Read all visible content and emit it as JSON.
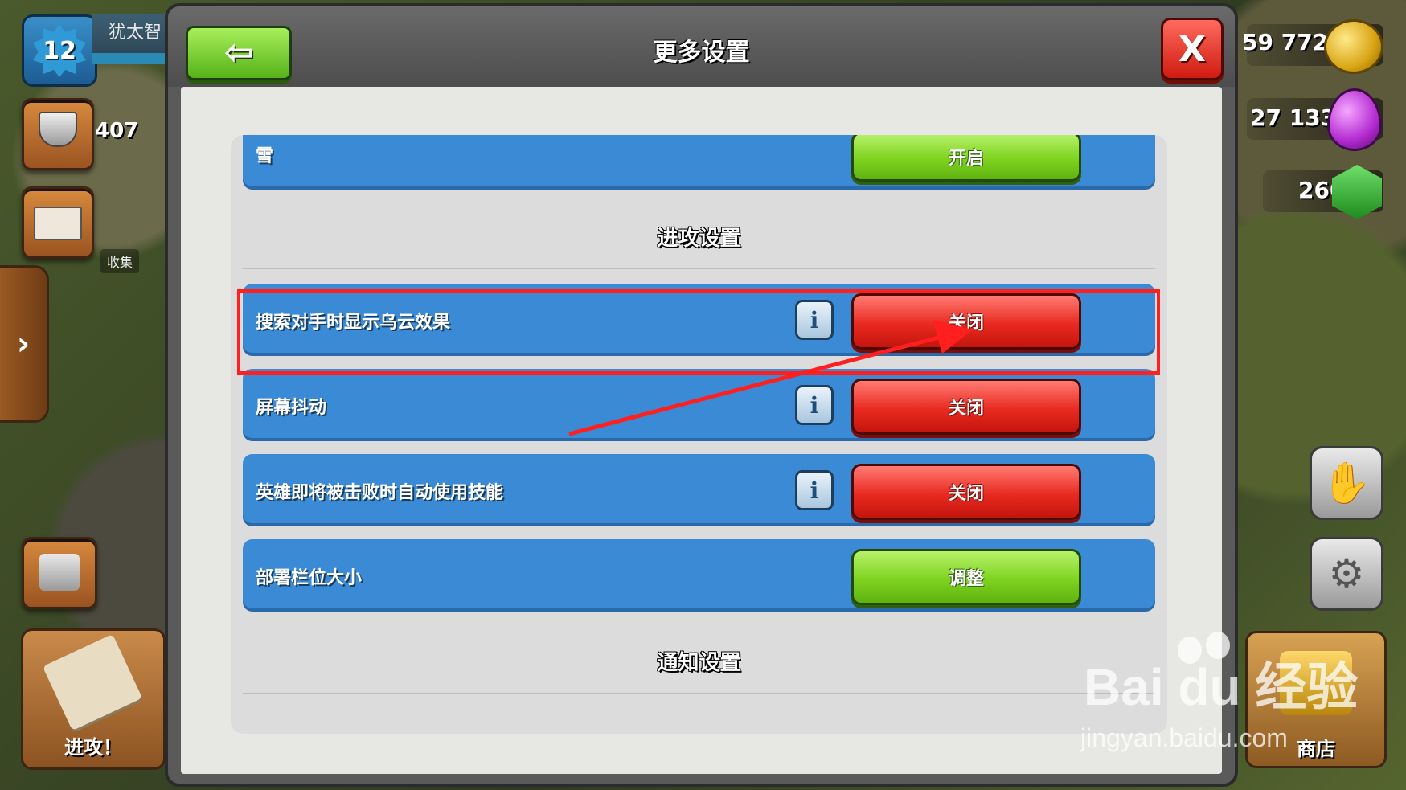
{
  "hud": {
    "level": "12",
    "player_name": "犹太智",
    "trophies": "407",
    "collect_label": "收集",
    "attack_label": "进攻！",
    "shop_label": "商店",
    "gold": "59 772",
    "elixir": "27 133",
    "gems": "260"
  },
  "dialog": {
    "title": "更多设置",
    "back_icon": "back-arrow-icon",
    "close_label": "X"
  },
  "settings": {
    "snow": {
      "label": "雪",
      "button": "开启",
      "button_color": "#7fd31f"
    },
    "attack_section_title": "进攻设置",
    "clouds": {
      "label": "搜索对手时显示乌云效果",
      "info": "i",
      "button": "关闭",
      "button_color": "#e92a21"
    },
    "screen_shake": {
      "label": "屏幕抖动",
      "info": "i",
      "button": "关闭",
      "button_color": "#e92a21"
    },
    "hero_ability": {
      "label": "英雄即将被击败时自动使用技能",
      "info": "i",
      "button": "关闭",
      "button_color": "#e92a21"
    },
    "deploy_bar": {
      "label": "部署栏位大小",
      "button": "调整",
      "button_color": "#7fd31f"
    },
    "notification_section_title": "通知设置"
  },
  "annotation": {
    "color": "#ff1f1f"
  },
  "watermark": {
    "brand": "Bai du 经验",
    "url": "jingyan.baidu.com"
  }
}
